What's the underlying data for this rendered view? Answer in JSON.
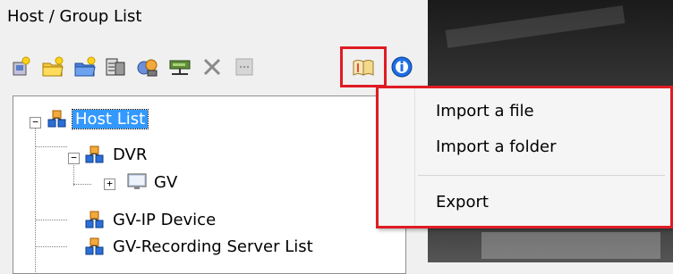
{
  "panel": {
    "title": "Host / Group List"
  },
  "toolbar": {
    "items": [
      {
        "name": "add-host",
        "icon": "add-host-icon"
      },
      {
        "name": "add-folder",
        "icon": "add-folder-icon"
      },
      {
        "name": "open-folder",
        "icon": "open-folder-icon"
      },
      {
        "name": "device-list",
        "icon": "device-list-icon"
      },
      {
        "name": "group",
        "icon": "group-icon"
      },
      {
        "name": "network",
        "icon": "network-icon"
      },
      {
        "name": "delete",
        "icon": "delete-icon"
      },
      {
        "name": "disabled",
        "icon": "grid-icon"
      },
      {
        "name": "import-export",
        "icon": "book-icon",
        "highlighted": true
      },
      {
        "name": "info",
        "icon": "info-icon"
      }
    ]
  },
  "tree": {
    "nodes": [
      {
        "label": "Host List",
        "selected": true,
        "expander": "−"
      },
      {
        "label": "DVR",
        "expander": "−"
      },
      {
        "label": "GV",
        "expander": "+"
      },
      {
        "label": "GV-IP Device"
      },
      {
        "label": "GV-Recording Server List"
      }
    ]
  },
  "context_menu": {
    "items": [
      {
        "label": "Import a file"
      },
      {
        "label": "Import a folder"
      },
      {
        "label": "Export"
      }
    ]
  },
  "colors": {
    "highlight_border": "#e01b24",
    "selection": "#3399ff"
  }
}
